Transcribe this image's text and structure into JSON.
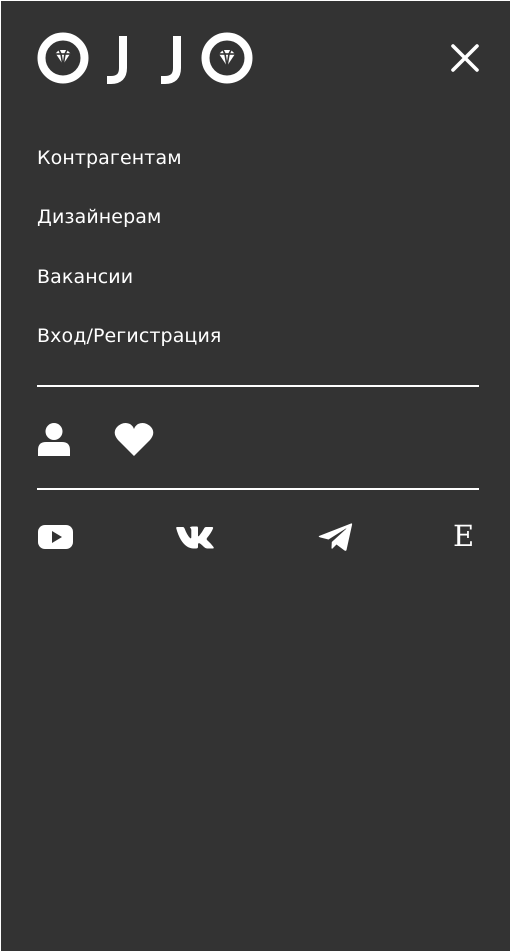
{
  "header": {
    "logo_icon": "ojjo-logo-icon",
    "close_icon": "close-icon"
  },
  "menu": {
    "items": [
      {
        "label": "Контрагентам"
      },
      {
        "label": "Дизайнерам"
      },
      {
        "label": "Вакансии"
      },
      {
        "label": "Вход/Регистрация"
      }
    ]
  },
  "actions": {
    "user_icon": "user-icon",
    "favorites_icon": "heart-icon"
  },
  "social": {
    "youtube_icon": "youtube-icon",
    "vk_icon": "vk-icon",
    "telegram_icon": "telegram-icon",
    "e_label": "E"
  },
  "colors": {
    "panel_background": "#333333",
    "foreground": "#ffffff"
  }
}
